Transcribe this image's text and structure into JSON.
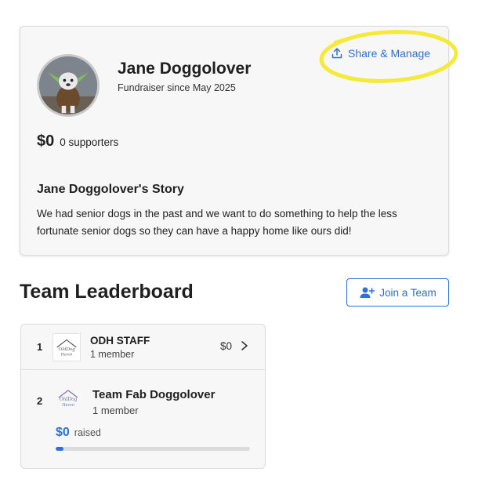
{
  "profile": {
    "name": "Jane Doggolover",
    "since": "Fundraiser since May 2025",
    "share_label": "Share & Manage",
    "amount": "$0",
    "supporters": "0 supporters",
    "story_title": "Jane Doggolover's Story",
    "story_text": "We had senior dogs in the past and we want to do something to help the less fortunate senior dogs so they can have a happy home like ours did!"
  },
  "leaderboard": {
    "title": "Team Leaderboard",
    "join_label": "Join a Team",
    "teams": [
      {
        "rank": "1",
        "name": "ODH STAFF",
        "members": "1 member",
        "amount": "$0"
      },
      {
        "rank": "2",
        "name": "Team Fab Doggolover",
        "members": "1 member",
        "raised_amount": "$0",
        "raised_label": "raised",
        "progress_fraction": 0.04
      }
    ]
  },
  "colors": {
    "accent": "#2f6fd6",
    "highlight": "#f5e93a"
  },
  "icons": {
    "share": "upload-icon",
    "join": "add-user-icon",
    "row_chevron": "chevron-right-icon"
  }
}
